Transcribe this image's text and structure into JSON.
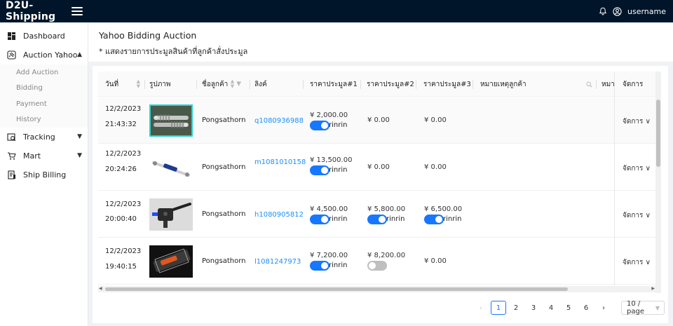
{
  "app": {
    "title": "D2U-Shipping"
  },
  "user": {
    "name": "username"
  },
  "sidebar": {
    "dashboard": "Dashboard",
    "auction": "Auction Yahoo",
    "auction_sub": [
      "Add Auction",
      "Bidding",
      "Payment",
      "History"
    ],
    "tracking": "Tracking",
    "mart": "Mart",
    "ship_billing": "Ship Billing"
  },
  "page": {
    "title": "Yahoo Bidding Auction",
    "subtitle": "* แสดงรายการประมูลสินค้าที่ลูกค้าสั่งประมูล"
  },
  "table": {
    "headers": {
      "date": "วันที่",
      "image": "รูปภาพ",
      "customer": "ชื่อลูกค้า",
      "link": "ลิงค์",
      "price1": "ราคาประมูล#1",
      "price2": "ราคาประมูล#2",
      "price3": "ราคาประมูล#3",
      "note": "หมายเหตุลูกค้า",
      "note2": "หมาย",
      "manage": "จัดการ"
    },
    "rows": [
      {
        "date": "12/2/2023",
        "time": "21:43:32",
        "customer": "Pongsathorn",
        "link": "q1080936988",
        "p1": "¥ 2,000.00",
        "p1_toggle": true,
        "p1_label": "rinrin",
        "p2": "¥ 0.00",
        "p2_toggle": null,
        "p2_label": "",
        "p3": "¥ 0.00",
        "p3_toggle": null,
        "p3_label": "",
        "action": "จัดการ"
      },
      {
        "date": "12/2/2023",
        "time": "20:24:26",
        "customer": "Pongsathorn",
        "link": "m1081010158",
        "p1": "¥ 13,500.00",
        "p1_toggle": true,
        "p1_label": "rinrin",
        "p2": "¥ 0.00",
        "p2_toggle": null,
        "p2_label": "",
        "p3": "¥ 0.00",
        "p3_toggle": null,
        "p3_label": "",
        "action": "จัดการ"
      },
      {
        "date": "12/2/2023",
        "time": "20:00:40",
        "customer": "Pongsathorn",
        "link": "h1080905812",
        "p1": "¥ 4,500.00",
        "p1_toggle": true,
        "p1_label": "rinrin",
        "p2": "¥ 5,800.00",
        "p2_toggle": true,
        "p2_label": "rinrin",
        "p3": "¥ 6,500.00",
        "p3_toggle": true,
        "p3_label": "rinrin",
        "action": "จัดการ"
      },
      {
        "date": "12/2/2023",
        "time": "19:40:15",
        "customer": "Pongsathorn",
        "link": "l1081247973",
        "p1": "¥ 7,200.00",
        "p1_toggle": true,
        "p1_label": "rinrin",
        "p2": "¥ 8,200.00",
        "p2_toggle": false,
        "p2_label": "",
        "p3": "¥ 0.00",
        "p3_toggle": null,
        "p3_label": "",
        "action": "จัดการ"
      }
    ]
  },
  "pagination": {
    "pages": [
      "1",
      "2",
      "3",
      "4",
      "5",
      "6"
    ],
    "current": "1",
    "page_size": "10 / page",
    "prev": "‹",
    "next": "›"
  },
  "colors": {
    "header_bg": "#001529",
    "accent": "#1677ff",
    "link": "#1890ff",
    "selected_thumb_border": "#2ad1d1"
  }
}
